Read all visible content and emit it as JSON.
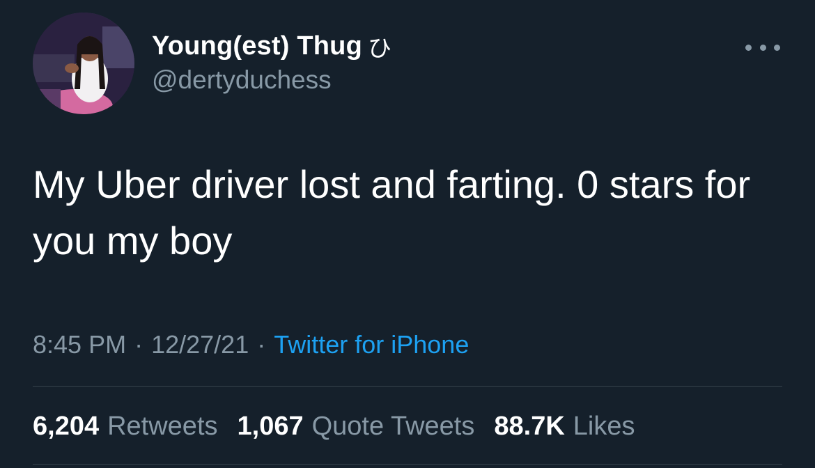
{
  "author": {
    "display_name": "Young(est) Thug",
    "name_emoji": "ひ",
    "handle": "@dertyduchess"
  },
  "tweet": {
    "text": "My Uber driver lost and farting. 0 stars for you my boy",
    "time": "8:45 PM",
    "separator": "·",
    "date": "12/27/21",
    "source": "Twitter for iPhone"
  },
  "stats": {
    "retweets": {
      "count": "6,204",
      "label": "Retweets"
    },
    "quote_tweets": {
      "count": "1,067",
      "label": "Quote Tweets"
    },
    "likes": {
      "count": "88.7K",
      "label": "Likes"
    }
  },
  "icons": {
    "more": "more-horizontal-icon"
  },
  "colors": {
    "background": "#15202b",
    "primary_text": "#ffffff",
    "secondary_text": "#8899a6",
    "link": "#1da1f2",
    "divider": "#38444d"
  }
}
